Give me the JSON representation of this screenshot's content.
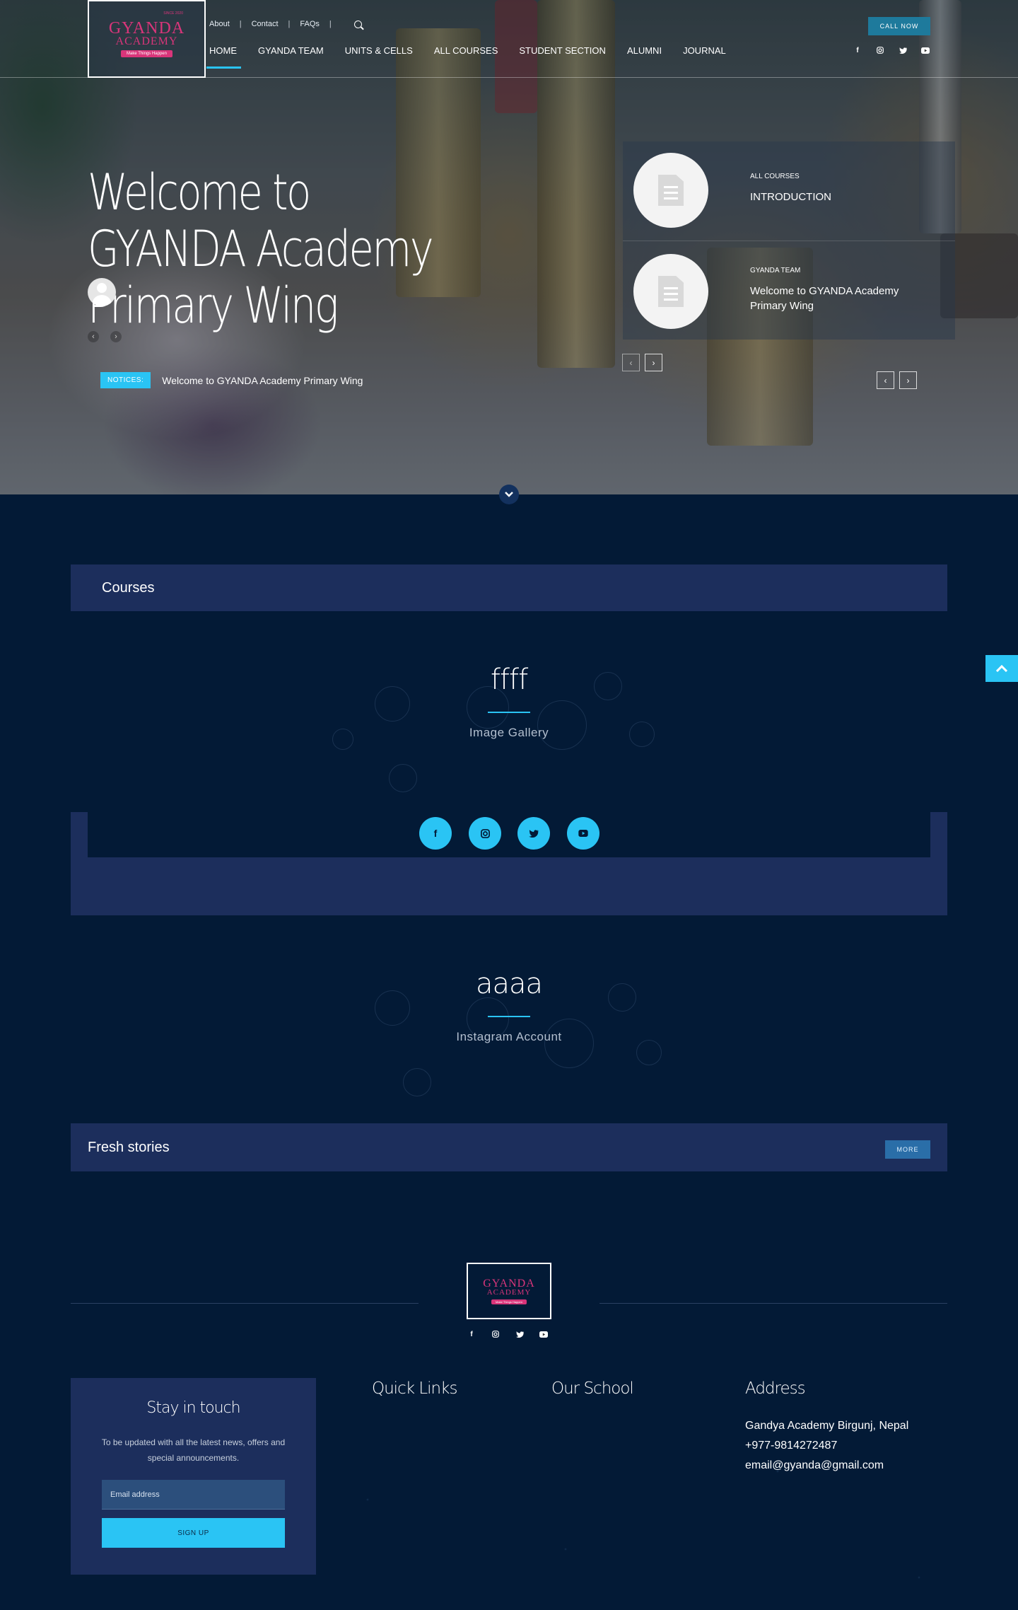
{
  "brand": {
    "logo_main": "GYANDA",
    "logo_sub": "ACADEMY",
    "logo_since": "SINCE 2020",
    "logo_tagline": "Make Things Happen"
  },
  "header": {
    "top_links": [
      "About",
      "Contact",
      "FAQs"
    ],
    "nav": [
      "HOME",
      "GYANDA TEAM",
      "UNITS & CELLS",
      "ALL COURSES",
      "STUDENT SECTION",
      "ALUMNI",
      "JOURNAL"
    ],
    "active_nav": "HOME",
    "call_label": "CALL NOW",
    "social": [
      "facebook-icon",
      "instagram-icon",
      "twitter-icon",
      "youtube-icon"
    ]
  },
  "hero": {
    "title": "Welcome to GYANDA Academy Primary Wing",
    "prev_glyph": "‹",
    "next_glyph": "›",
    "notices_label": "NOTICES:",
    "notices_text": "Welcome to GYANDA Academy Primary Wing",
    "panel_items": [
      {
        "category": "ALL COURSES",
        "title": "INTRODUCTION"
      },
      {
        "category": "GYANDA TEAM",
        "title": "Welcome to GYANDA Academy Primary Wing"
      }
    ]
  },
  "sections": {
    "courses_title": "Courses",
    "block1_title": "ffff",
    "block1_subtitle": "Image Gallery",
    "block2_title": "aaaa",
    "block2_subtitle": "Instagram Account",
    "fresh_title": "Fresh stories",
    "more_label": "MORE"
  },
  "footer": {
    "stay_title": "Stay in touch",
    "stay_text": "To be updated with all the latest news, offers and special announcements.",
    "email_placeholder": "Email address",
    "signup_label": "SIGN UP",
    "quick_links_title": "Quick Links",
    "our_school_title": "Our School",
    "address_title": "Address",
    "address_lines": [
      "Gandya Academy Birgunj, Nepal",
      "+977-9814272487",
      "email@gyanda@gmail.com"
    ]
  },
  "colors": {
    "accent": "#2ac4f4",
    "background": "#031a36",
    "panel": "#1c2e5c",
    "brand_pink": "#d9357a"
  }
}
